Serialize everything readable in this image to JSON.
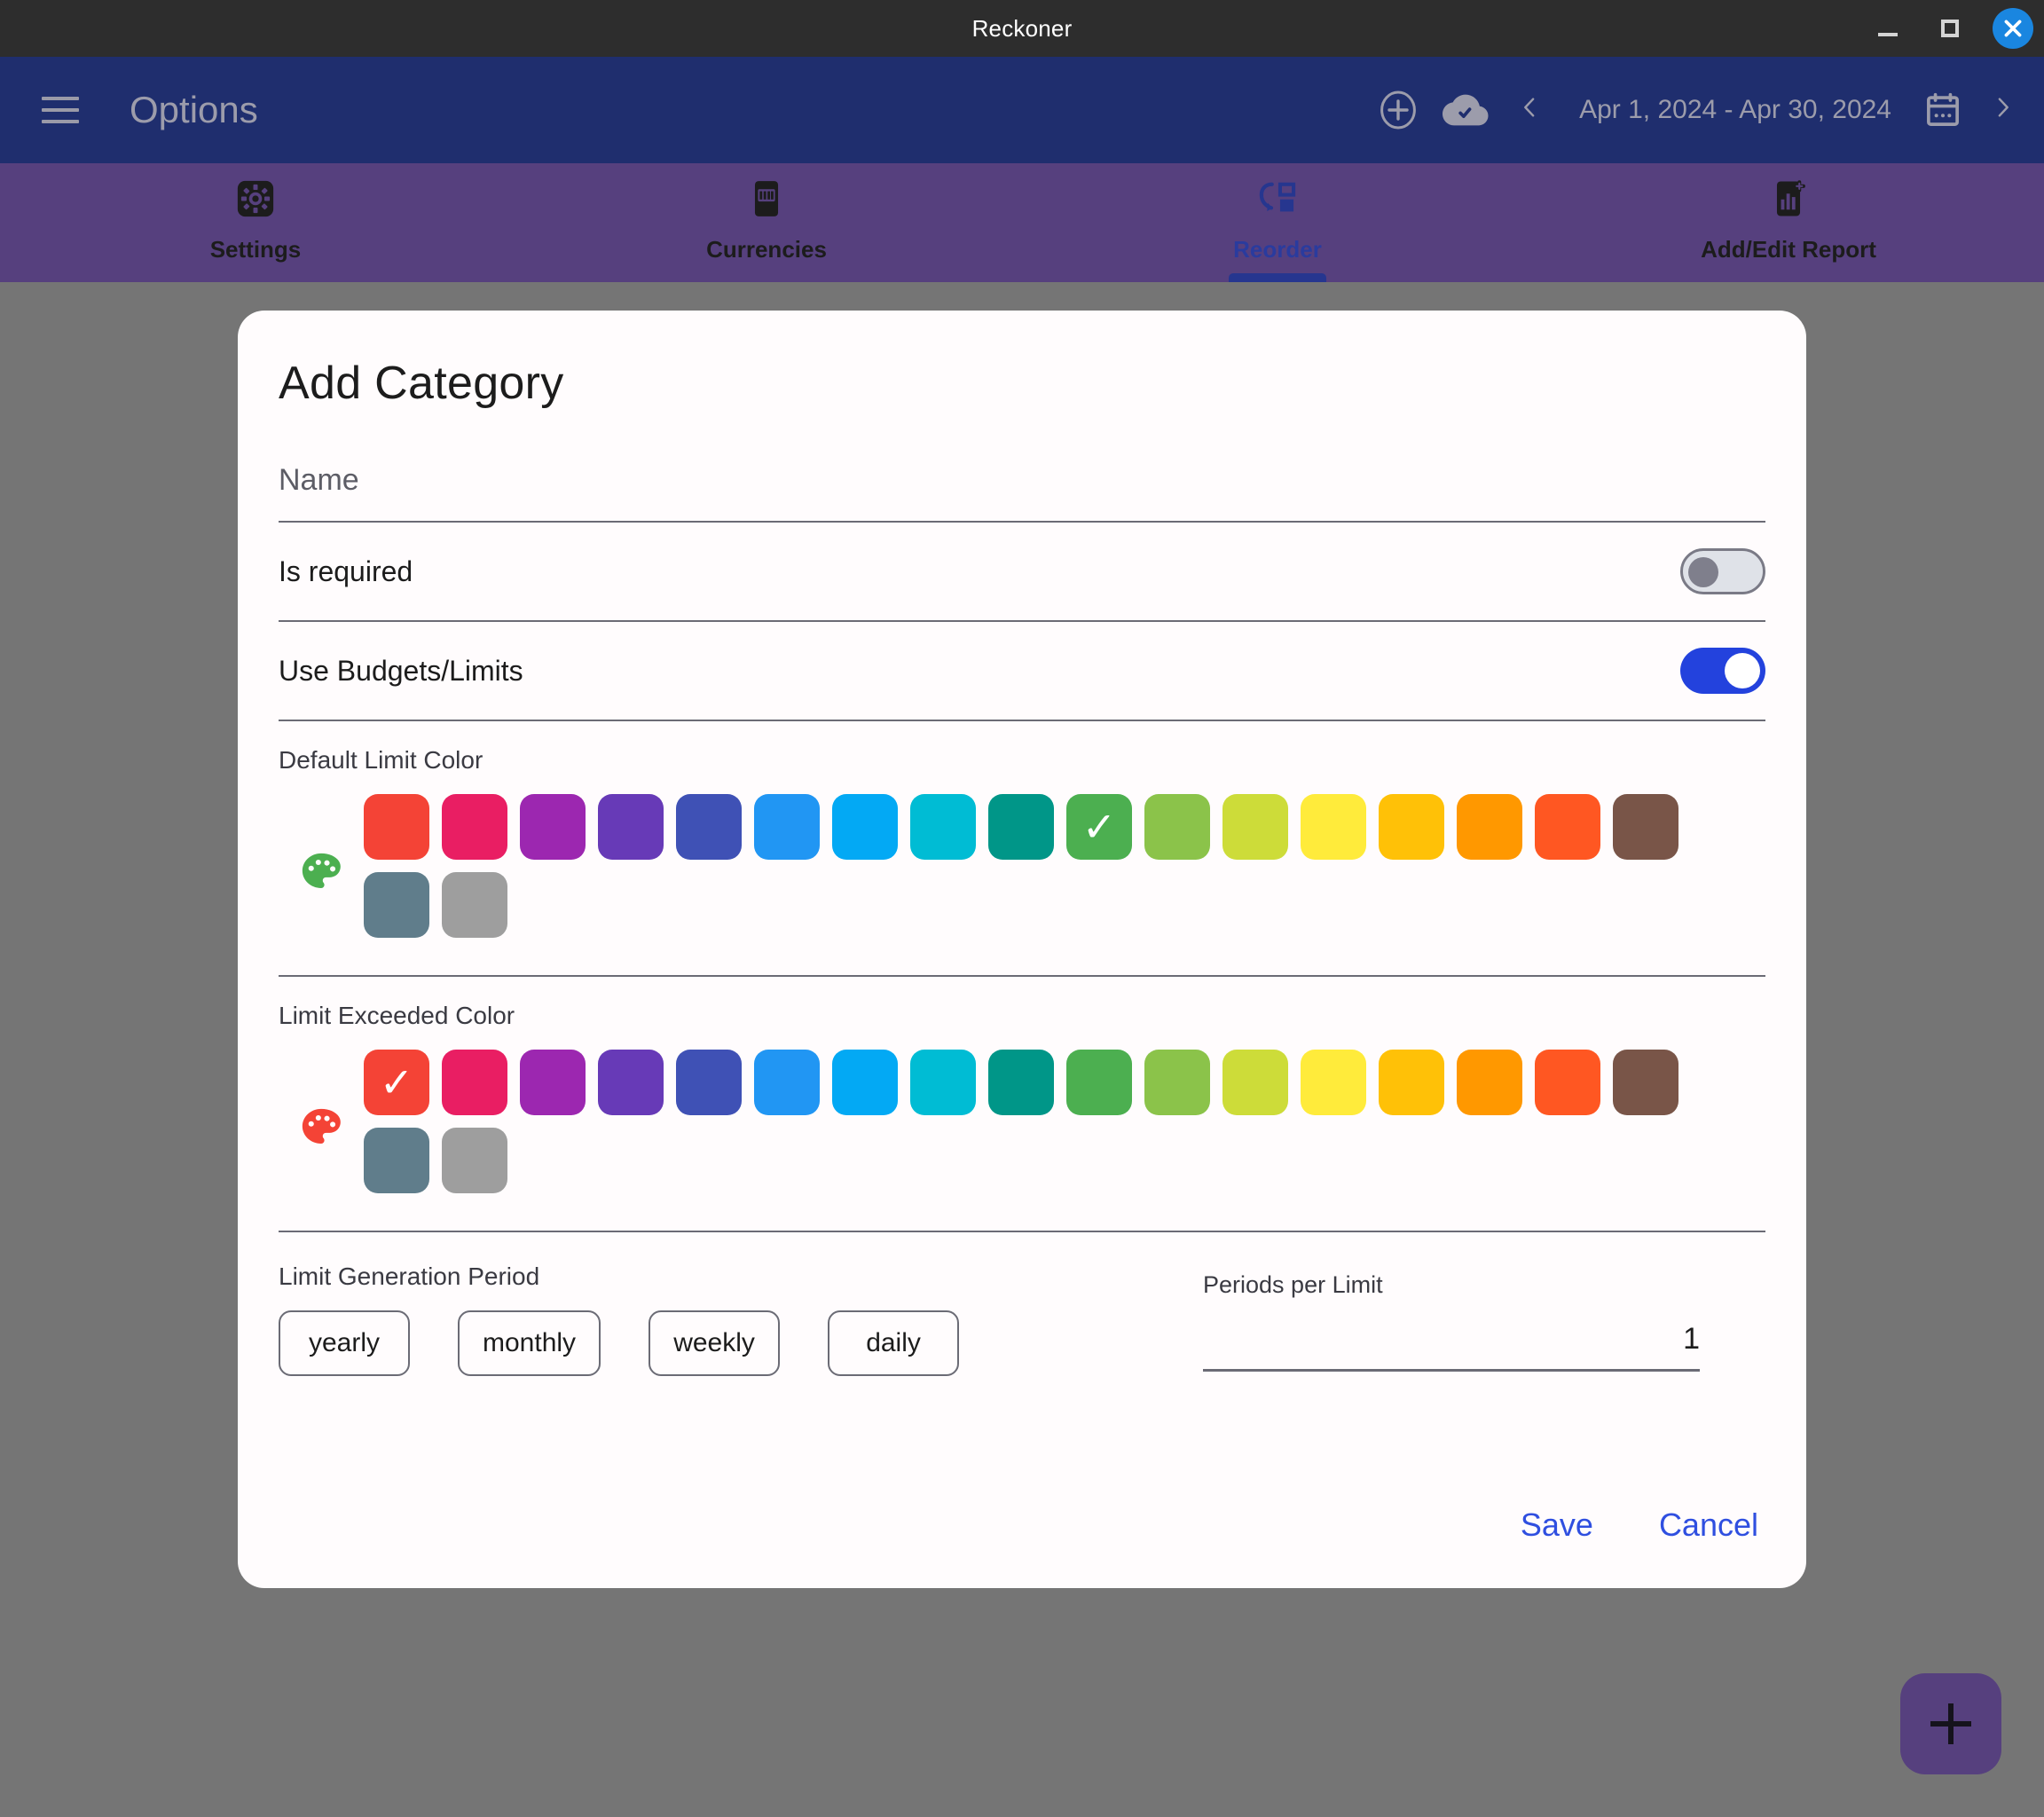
{
  "window": {
    "title": "Reckoner",
    "minimize_icon": "minimize-icon",
    "maximize_icon": "maximize-icon",
    "close_icon": "close-icon"
  },
  "appbar": {
    "menu_icon": "hamburger-menu-icon",
    "title": "Options",
    "add_icon": "add-circle-icon",
    "cloud_icon": "cloud-done-icon",
    "prev_icon": "chevron-left-icon",
    "date_range": "Apr 1, 2024 - Apr 30, 2024",
    "calendar_icon": "calendar-icon",
    "next_icon": "chevron-right-icon"
  },
  "tabs": [
    {
      "label": "Settings",
      "icon": "settings-gear-icon",
      "active": false
    },
    {
      "label": "Currencies",
      "icon": "currency-bill-icon",
      "active": false
    },
    {
      "label": "Reorder",
      "icon": "reorder-icon",
      "active": true
    },
    {
      "label": "Add/Edit Report",
      "icon": "add-report-icon",
      "active": false
    }
  ],
  "dialog": {
    "title": "Add Category",
    "name_field": {
      "label": "Name",
      "placeholder": "Name",
      "value": ""
    },
    "is_required": {
      "label": "Is required",
      "state": "off"
    },
    "use_budgets": {
      "label": "Use Budgets/Limits",
      "state": "on"
    },
    "default_limit_color": {
      "label": "Default Limit Color",
      "palette_icon": "palette-icon",
      "palette_icon_color": "#4CAF50",
      "selected_index": 9,
      "swatches": [
        "#F44336",
        "#E91E63",
        "#9C27B0",
        "#673AB7",
        "#3F51B5",
        "#2196F3",
        "#03A9F4",
        "#00BCD4",
        "#009688",
        "#4CAF50",
        "#8BC34A",
        "#CDDC39",
        "#FFEB3B",
        "#FFC107",
        "#FF9800",
        "#FF5722",
        "#795548",
        "#607D8B",
        "#9E9E9E"
      ]
    },
    "limit_exceeded_color": {
      "label": "Limit Exceeded Color",
      "palette_icon": "palette-icon",
      "palette_icon_color": "#F44336",
      "selected_index": 0,
      "swatches": [
        "#F44336",
        "#E91E63",
        "#9C27B0",
        "#673AB7",
        "#3F51B5",
        "#2196F3",
        "#03A9F4",
        "#00BCD4",
        "#009688",
        "#4CAF50",
        "#8BC34A",
        "#CDDC39",
        "#FFEB3B",
        "#FFC107",
        "#FF9800",
        "#FF5722",
        "#795548",
        "#607D8B",
        "#9E9E9E"
      ]
    },
    "limit_generation_period": {
      "label": "Limit Generation Period",
      "options": [
        "yearly",
        "monthly",
        "weekly",
        "daily"
      ]
    },
    "periods_per_limit": {
      "label": "Periods per Limit",
      "value": "1"
    },
    "save_label": "Save",
    "cancel_label": "Cancel",
    "check_glyph": "✓"
  },
  "fab": {
    "icon": "plus-icon"
  },
  "colors": {
    "titlebar": "#2d2d2d",
    "appbar": "#1f2e6e",
    "tabbar": "#56407e",
    "backdrop": "#757575",
    "accent_link": "#2f4fe0",
    "toggle_on": "#2342dd",
    "close_button": "#1a86e0",
    "active_tab_text": "#2a3b9e"
  }
}
